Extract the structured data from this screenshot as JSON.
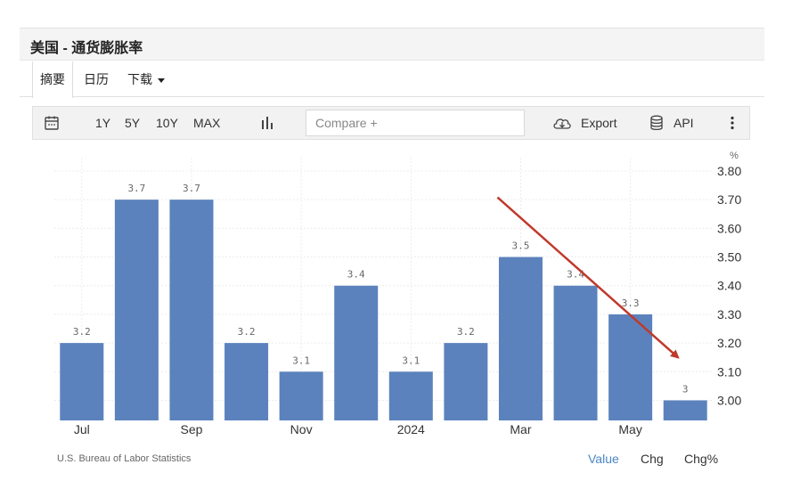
{
  "header": {
    "title": "美国 - 通货膨胀率"
  },
  "tabs": [
    {
      "label": "摘要"
    },
    {
      "label": "日历"
    },
    {
      "label": "下载"
    }
  ],
  "toolbar": {
    "ranges": [
      "1Y",
      "5Y",
      "10Y",
      "MAX"
    ],
    "compare_placeholder": "Compare +",
    "export_label": "Export",
    "api_label": "API"
  },
  "footer": {
    "source": "U.S. Bureau of Labor Statistics",
    "options": [
      "Value",
      "Chg",
      "Chg%"
    ],
    "selected": "Value"
  },
  "colors": {
    "bar": "#5b82bd",
    "arrow": "#c0392b",
    "active_link": "#4a86c5"
  },
  "chart_data": {
    "type": "bar",
    "unit": "%",
    "x_tick_labels": [
      "Jul",
      "Sep",
      "Nov",
      "2024",
      "Mar",
      "May"
    ],
    "values": [
      3.2,
      3.7,
      3.7,
      3.2,
      3.1,
      3.4,
      3.1,
      3.2,
      3.5,
      3.4,
      3.3,
      3.0
    ],
    "data_labels": [
      "3.2",
      "3.7",
      "3.7",
      "3.2",
      "3.1",
      "3.4",
      "3.1",
      "3.2",
      "3.5",
      "3.4",
      "3.3",
      "3"
    ],
    "y_ticks": [
      "3.80",
      "3.70",
      "3.60",
      "3.50",
      "3.40",
      "3.30",
      "3.20",
      "3.10",
      "3.00"
    ],
    "ylim": [
      2.93,
      3.8
    ],
    "y_axis_side": "right",
    "grid": true,
    "annotation": {
      "type": "arrow",
      "direction": "down-right",
      "from_bar_index": 8,
      "to_bar_index": 11
    }
  }
}
